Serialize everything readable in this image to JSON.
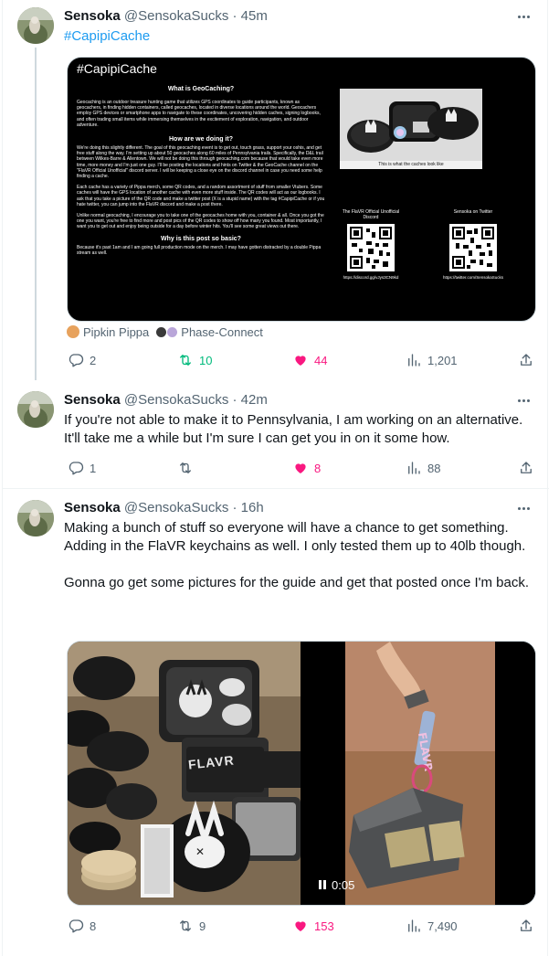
{
  "tweets": [
    {
      "name": "Sensoka",
      "handle": "@SensokaSucks",
      "separator": "·",
      "time": "45m",
      "hashtag": "#CapipiCache",
      "tagged": [
        "Pipkin Pippa",
        "Phase-Connect"
      ],
      "image": {
        "title": "#CapipiCache",
        "what_heading": "What is GeoCaching?",
        "what_text": "Geocaching is an outdoor treasure hunting game that utilizes GPS coordinates to guide participants, known as geocachers, in finding hidden containers, called geocaches, located in diverse locations around the world. Geocachers employ GPS devices or smartphone apps to navigate to these coordinates, uncovering hidden caches, signing logbooks, and often trading small items while immersing themselves in the excitement of exploration, navigation, and outdoor adventure.",
        "how_heading": "How are we doing it?",
        "how_text": "We're doing this slightly different. The goal of this geocaching event is to get out, touch grass, support your oshis, and get free stuff along the way. I'm setting up about 50 geocaches along 60 miles of Pennsylvania trails. Specifically, the D&L trail between Wilkes-Barre & Allentown. We will not be doing this through geocaching.com because that would take even more time, more money and I'm just one guy. I'll be posting the locations and hints on Twitter & the GeoCache channel on the \"FlaVR Official Unofficial\" discord server. I will be keeping a close eye on the discord channel in case you need some help finding a cache.",
        "each_text": "Each cache has a variety of Pippa merch, some QR codes, and a random assortment of stuff from smaller Vtubers. Some caches will have the GPS location of another cache with even more stuff inside. The QR codes will act as our logbooks. I ask that you take a picture of the QR code and make a twitter post (X is a stupid name) with the tag #CapipiCache or if you hate twitter, you can jump into the FlaVR discord and make a post there.",
        "unlike_text": "Unlike normal geocaching, I encourage you to take one of the geocaches home with you, container & all. Once you got the one you want, you're free to find more and post pics of the QR codes to show off how many you found. Most importantly, I want you to get out and enjoy being outside for a day before winter hits. You'll see some great views out there.",
        "why_heading": "Why is this post so basic?",
        "why_text": "Because it's past 1am and I am going full production mode on the merch. I may have gotten distracted by a double Pippa stream as well.",
        "photo_caption": "This is what the caches look like",
        "qr1_title": "The FlaVR Official Unofficial Discord",
        "qr1_url": "https://discord.gg/vJys3CN9kd",
        "qr2_title": "Sensoka on Twitter",
        "qr2_url": "https://twitter.com/SensokaSucks"
      },
      "stats": {
        "replies": "2",
        "retweets": "10",
        "likes": "44",
        "views": "1,201"
      }
    },
    {
      "name": "Sensoka",
      "handle": "@SensokaSucks",
      "separator": "·",
      "time": "42m",
      "text": "If you're not able to make it to Pennsylvania, I am working on an alternative. It'll take me a while but I'm sure I can get you in on it some how.",
      "stats": {
        "replies": "1",
        "retweets": "",
        "likes": "8",
        "views": "88"
      }
    },
    {
      "name": "Sensoka",
      "handle": "@SensokaSucks",
      "separator": "·",
      "time": "16h",
      "text_1": "Making a bunch of stuff so everyone will have a chance to get something. Adding in the FlaVR keychains as well. I only tested them up to 40lb though.",
      "text_2": "Gonna go get some pictures for the guide and get that posted once I'm back.",
      "video_time": "0:05",
      "photo_logo": "FLAVR",
      "stats": {
        "replies": "8",
        "retweets": "9",
        "likes": "153",
        "views": "7,490"
      }
    }
  ],
  "colors": {
    "text": "#0f1419",
    "secondary": "#536471",
    "link": "#1d9bf0",
    "retweet": "#00ba7c",
    "like": "#f91880",
    "border": "#eff3f4"
  },
  "icons": [
    "more-icon",
    "reply-icon",
    "retweet-icon",
    "heart-icon",
    "views-icon",
    "share-icon",
    "pause-icon"
  ]
}
